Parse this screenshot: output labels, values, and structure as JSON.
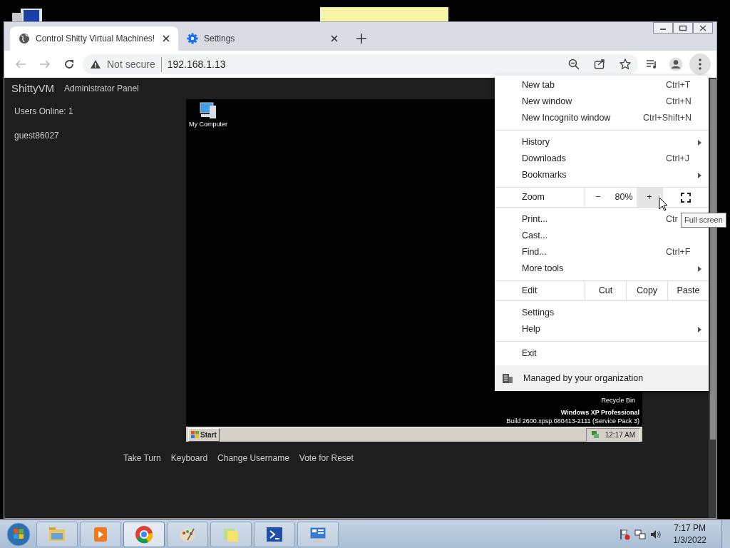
{
  "browser": {
    "tabs": [
      {
        "title": "Control Shitty Virtual Machines!",
        "kind": "page",
        "selected": true
      },
      {
        "title": "Settings",
        "kind": "settings",
        "selected": false
      }
    ],
    "address": {
      "security": "Not secure",
      "url": "192.168.1.13"
    }
  },
  "page": {
    "brand": "ShittyVM",
    "nav_link": "Administrator Panel",
    "users_online": "Users Online: 1",
    "users": [
      "guest86027"
    ],
    "vm": {
      "desktop_icons": [
        {
          "label": "My Computer",
          "kind": "computer"
        },
        {
          "label": "Recycle Bin",
          "kind": "bin"
        }
      ],
      "edition": "Windows XP Professional",
      "build": "Build 2600.xpsp.080413-2111 (Service Pack 3)",
      "start": "Start",
      "clock": "12:17 AM"
    },
    "buttons": [
      "Take Turn",
      "Keyboard",
      "Change Username",
      "Vote for Reset"
    ]
  },
  "menu": {
    "items": [
      {
        "kind": "item",
        "label": "New tab",
        "shortcut": "Ctrl+T",
        "submenu": false
      },
      {
        "kind": "item",
        "label": "New window",
        "shortcut": "Ctrl+N",
        "submenu": false
      },
      {
        "kind": "item",
        "label": "New Incognito window",
        "shortcut": "Ctrl+Shift+N",
        "submenu": false
      },
      {
        "kind": "separator"
      },
      {
        "kind": "item",
        "label": "History",
        "submenu": true
      },
      {
        "kind": "item",
        "label": "Downloads",
        "shortcut": "Ctrl+J",
        "submenu": false
      },
      {
        "kind": "item",
        "label": "Bookmarks",
        "submenu": true
      },
      {
        "kind": "separator"
      },
      {
        "kind": "zoom",
        "label": "Zoom",
        "minus": "−",
        "level": "80%",
        "plus": "+"
      },
      {
        "kind": "separator"
      },
      {
        "kind": "item",
        "label": "Print...",
        "shortcut": "Ctr",
        "submenu": false
      },
      {
        "kind": "item",
        "label": "Cast...",
        "submenu": false
      },
      {
        "kind": "item",
        "label": "Find...",
        "shortcut": "Ctrl+F",
        "submenu": false
      },
      {
        "kind": "item",
        "label": "More tools",
        "submenu": true
      },
      {
        "kind": "separator"
      },
      {
        "kind": "edit",
        "label": "Edit",
        "actions": [
          "Cut",
          "Copy",
          "Paste"
        ]
      },
      {
        "kind": "separator"
      },
      {
        "kind": "item",
        "label": "Settings",
        "submenu": false
      },
      {
        "kind": "item",
        "label": "Help",
        "submenu": true
      },
      {
        "kind": "separator"
      },
      {
        "kind": "item",
        "label": "Exit",
        "submenu": false
      },
      {
        "kind": "managed",
        "label": "Managed by your organization"
      }
    ]
  },
  "tooltip": "Full screen",
  "taskbar": {
    "apps": [
      {
        "kind": "folder",
        "active": false
      },
      {
        "kind": "media",
        "active": false
      },
      {
        "kind": "browser",
        "active": true
      },
      {
        "kind": "paint",
        "active": false
      },
      {
        "kind": "notes",
        "active": false
      },
      {
        "kind": "terminal",
        "active": false
      },
      {
        "kind": "panel",
        "active": false
      }
    ],
    "time": "7:17 PM",
    "date": "1/3/2022"
  }
}
